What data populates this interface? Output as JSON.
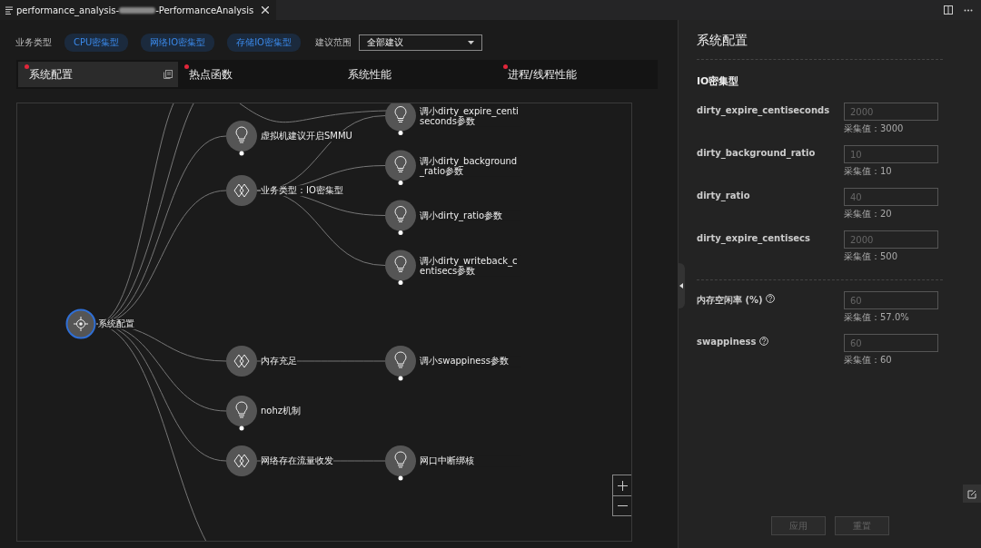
{
  "tab": {
    "title_start": "performance_analysis-",
    "title_end": "-PerformanceAnalysis"
  },
  "filters": {
    "label": "业务类型",
    "chips": [
      "CPU密集型",
      "网络IO密集型",
      "存储IO密集型"
    ],
    "scope_label": "建议范围",
    "scope_value": "全部建议"
  },
  "tabs": [
    {
      "label": "系统配置",
      "selected": true,
      "alert": true
    },
    {
      "label": "热点函数",
      "selected": false,
      "alert": true
    },
    {
      "label": "系统性能",
      "selected": false,
      "alert": false
    },
    {
      "label": "进程/线程性能",
      "selected": false,
      "alert": true
    }
  ],
  "tree": {
    "label": "系统配置",
    "kind": "root",
    "children": [
      {
        "label": "虚拟机建议开启SMMU",
        "kind": "bulb"
      },
      {
        "label": "业务类型：IO密集型",
        "kind": "diamond",
        "children": [
          {
            "label": "调小dirty_expire_centiseconds参数",
            "kind": "bulb"
          },
          {
            "label": "调小dirty_background_ratio参数",
            "kind": "bulb"
          },
          {
            "label": "调小dirty_ratio参数",
            "kind": "bulb"
          },
          {
            "label": "调小dirty_writeback_centisecs参数",
            "kind": "bulb"
          }
        ]
      },
      {
        "label": "内存充足",
        "kind": "diamond",
        "children": [
          {
            "label": "调小swappiness参数",
            "kind": "bulb"
          }
        ]
      },
      {
        "label": "nohz机制",
        "kind": "bulb"
      },
      {
        "label": "网络存在流量收发",
        "kind": "diamond",
        "children": [
          {
            "label": "网口中断绑核",
            "kind": "bulb"
          }
        ]
      }
    ]
  },
  "panel": {
    "title": "系统配置",
    "section": "IO密集型",
    "groups": [
      [
        {
          "label": "dirty_expire_centiseconds",
          "placeholder": "2000",
          "note": "采集值：3000",
          "help": false
        },
        {
          "label": "dirty_background_ratio",
          "placeholder": "10",
          "note": "采集值：10",
          "help": false
        },
        {
          "label": "dirty_ratio",
          "placeholder": "40",
          "note": "采集值：20",
          "help": false
        },
        {
          "label": "dirty_expire_centisecs",
          "placeholder": "2000",
          "note": "采集值：500",
          "help": false
        }
      ],
      [
        {
          "label": "内存空闲率 (%)",
          "placeholder": "60",
          "note": "采集值：57.0%",
          "help": true
        },
        {
          "label": "swappiness",
          "placeholder": "60",
          "note": "采集值：60",
          "help": true
        }
      ]
    ],
    "buttons": [
      {
        "label": "应用",
        "disabled": true
      },
      {
        "label": "重置",
        "disabled": true
      }
    ]
  }
}
